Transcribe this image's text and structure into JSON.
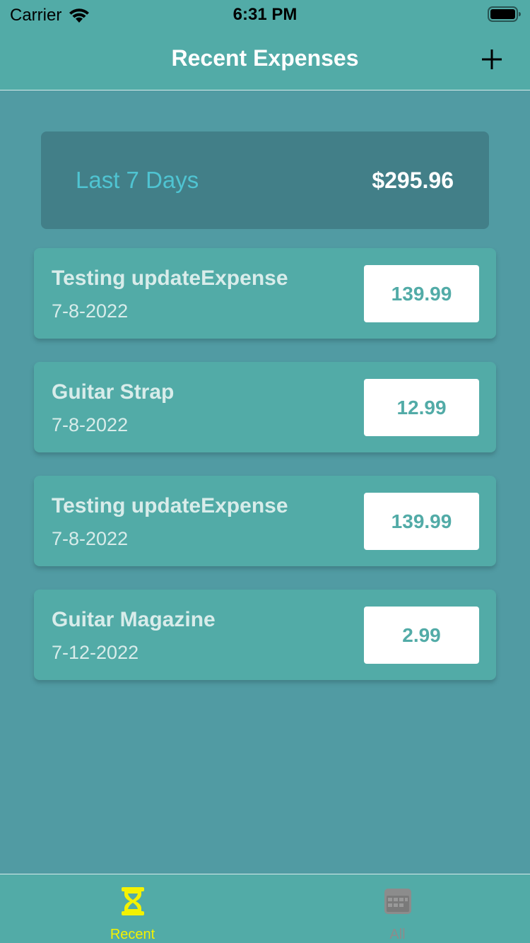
{
  "status_bar": {
    "carrier": "Carrier",
    "time": "6:31 PM"
  },
  "nav": {
    "title": "Recent Expenses",
    "add_icon": "plus-icon"
  },
  "summary": {
    "label": "Last 7 Days",
    "total": "$295.96"
  },
  "expenses": [
    {
      "description": "Testing updateExpense",
      "date": "7-8-2022",
      "amount": "139.99"
    },
    {
      "description": "Guitar Strap",
      "date": "7-8-2022",
      "amount": "12.99"
    },
    {
      "description": "Testing updateExpense",
      "date": "7-8-2022",
      "amount": "139.99"
    },
    {
      "description": "Guitar Magazine",
      "date": "7-12-2022",
      "amount": "2.99"
    }
  ],
  "tabs": [
    {
      "label": "Recent",
      "icon": "hourglass-icon",
      "active": true
    },
    {
      "label": "All",
      "icon": "calendar-icon",
      "active": false
    }
  ],
  "colors": {
    "header_bg": "#52aba7",
    "content_bg": "#519ba3",
    "summary_bg": "#427f88",
    "summary_label": "#4fc4d2",
    "item_bg": "#52aba7",
    "item_text": "#d8ecea",
    "active_tab": "#f4f200",
    "inactive_tab": "#8c8c8c"
  }
}
